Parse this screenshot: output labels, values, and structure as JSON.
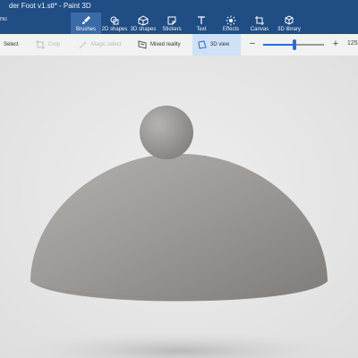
{
  "app": {
    "title": "der Foot v1.stl* - Paint 3D",
    "menu_fragment": "nu"
  },
  "ribbon": {
    "tabs": [
      {
        "label": "Brushes",
        "icon": "brush-icon"
      },
      {
        "label": "2D shapes",
        "icon": "2d-shapes-icon"
      },
      {
        "label": "3D shapes",
        "icon": "3d-shapes-icon"
      },
      {
        "label": "Stickers",
        "icon": "sticker-icon"
      },
      {
        "label": "Text",
        "icon": "text-icon"
      },
      {
        "label": "Effects",
        "icon": "effects-icon"
      },
      {
        "label": "Canvas",
        "icon": "canvas-icon"
      },
      {
        "label": "3D library",
        "icon": "3d-library-icon"
      }
    ],
    "active_tab": "Brushes"
  },
  "toolbar": {
    "select_label": "Select",
    "crop_label": "Crop",
    "magic_select_label": "Magic select",
    "mixed_reality_label": "Mixed reality",
    "view3d_label": "3D view",
    "zoom_value": "125",
    "zoom_fraction": 0.51
  },
  "colors": {
    "title_bg": "#1f4d84",
    "ribbon_active": "#3a6aa8",
    "accent": "#2d6bd0",
    "canvas_bg": "#e6e6e6"
  }
}
